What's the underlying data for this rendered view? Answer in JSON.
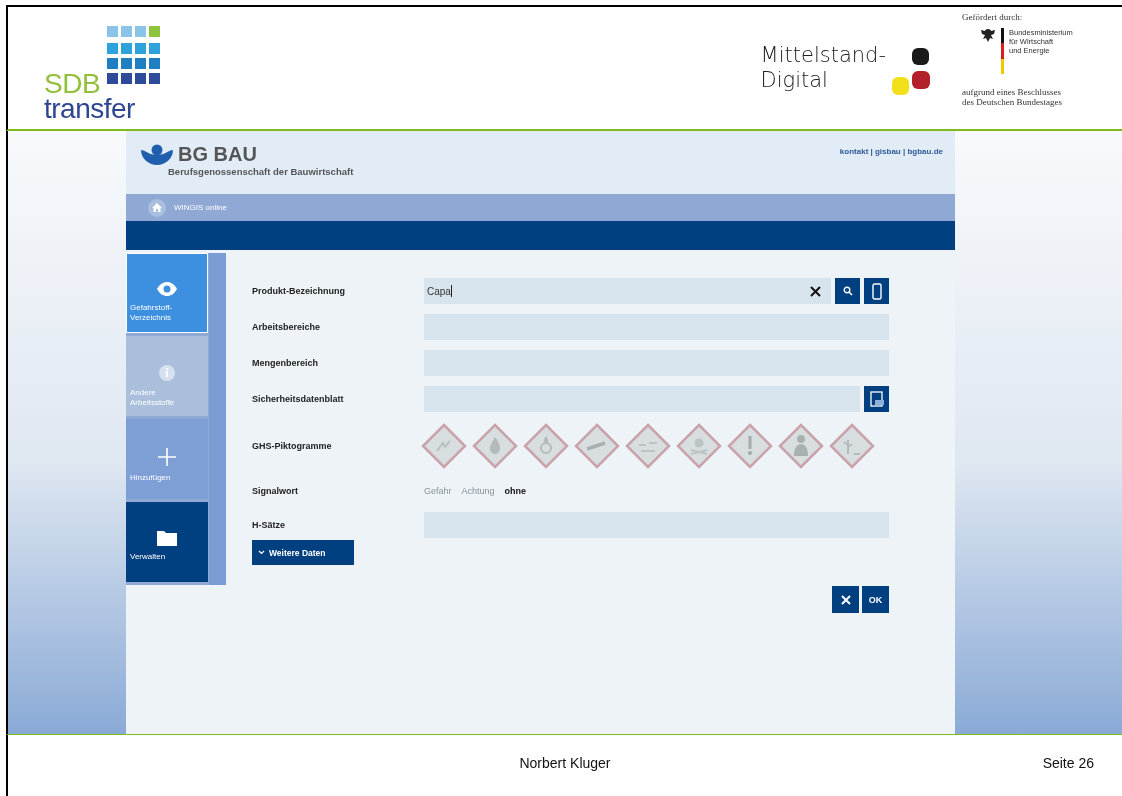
{
  "slide_header": {
    "logo": {
      "top": "SDB",
      "bottom": "transfer"
    },
    "program_logo": {
      "line_1": "Mittelstand-",
      "line_2": "Digital"
    },
    "funding": {
      "caption": "Gefördert durch:",
      "ministry": [
        "Bundesministerium",
        "für Wirtschaft",
        "und Energie"
      ],
      "note": [
        "aufgrund eines Beschlusses",
        "des Deutschen Bundestages"
      ]
    }
  },
  "app": {
    "brand": "BG BAU",
    "brand_subtitle": "Berufsgenossenschaft der Bauwirtschaft",
    "top_links": "kontakt | gisbau | bgbau.de",
    "breadcrumb": "WINGIS online",
    "sidebar": [
      {
        "kind": "eye",
        "label": "Gefahrstoff-Verzeichnis",
        "selected": true,
        "color": "#3d8fe0"
      },
      {
        "kind": "info",
        "label": "Andere Arbeitsstoffe",
        "selected": false,
        "color": "#a9bfdc"
      },
      {
        "kind": "plus",
        "label": "Hinzufügen",
        "selected": false,
        "color": "#7d9fd6"
      },
      {
        "kind": "folder",
        "label": "Verwalten",
        "selected": false,
        "color": "#003f80"
      }
    ],
    "form": [
      {
        "kind": "search",
        "label": "Produkt-Bezeichnung",
        "value": "Capa"
      },
      {
        "kind": "text",
        "label": "Arbeitsbereiche"
      },
      {
        "kind": "text",
        "label": "Mengenbereich"
      },
      {
        "kind": "document",
        "label": "Sicherheitsdatenblatt"
      },
      {
        "kind": "pictograms",
        "label": "GHS-Piktogramme"
      },
      {
        "kind": "signal",
        "label": "Signalwort",
        "options": [
          {
            "label": "Gefahr",
            "selected": false
          },
          {
            "label": "Achtung",
            "selected": false
          },
          {
            "label": "ohne",
            "selected": true
          }
        ]
      },
      {
        "kind": "text",
        "label": "H-Sätze"
      }
    ],
    "more_button": "Weitere Daten",
    "ok_button": "OK"
  },
  "footer": {
    "author": "Norbert Kluger",
    "page": "Seite 26"
  }
}
